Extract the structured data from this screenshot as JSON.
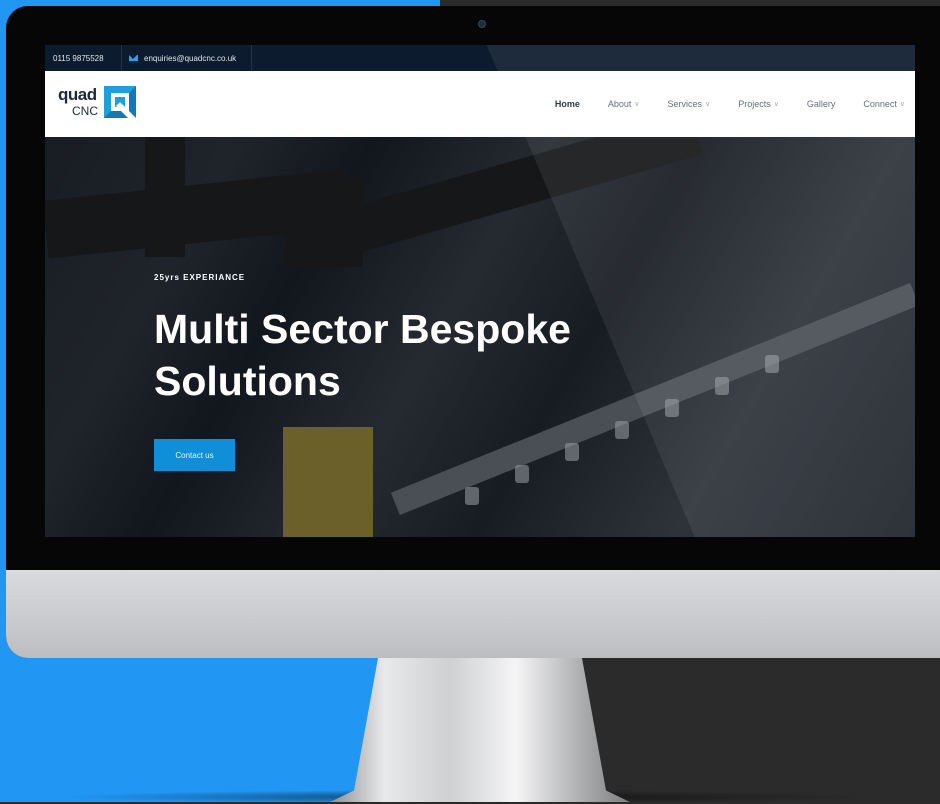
{
  "topbar": {
    "phone": "0115 9875528",
    "email": "enquiries@quadcnc.co.uk"
  },
  "logo": {
    "line1": "quad",
    "line2": "CNC"
  },
  "nav": {
    "items": [
      {
        "label": "Home",
        "dropdown": false
      },
      {
        "label": "About",
        "dropdown": true
      },
      {
        "label": "Services",
        "dropdown": true
      },
      {
        "label": "Projects",
        "dropdown": true
      },
      {
        "label": "Gallery",
        "dropdown": false
      },
      {
        "label": "Connect",
        "dropdown": true
      }
    ]
  },
  "hero": {
    "subtitle": "25yrs EXPERIANCE",
    "headline": "Multi Sector Bespoke Solutions",
    "cta": "Contact us"
  },
  "colors": {
    "accent": "#0f8fd8",
    "topbar": "#0c1b2e",
    "background_left": "#2196f3",
    "background_right": "#2b2b2b"
  },
  "icons": [
    "mail-icon",
    "chevron-down-icon",
    "webcam-icon",
    "quad-cnc-logo-icon"
  ]
}
